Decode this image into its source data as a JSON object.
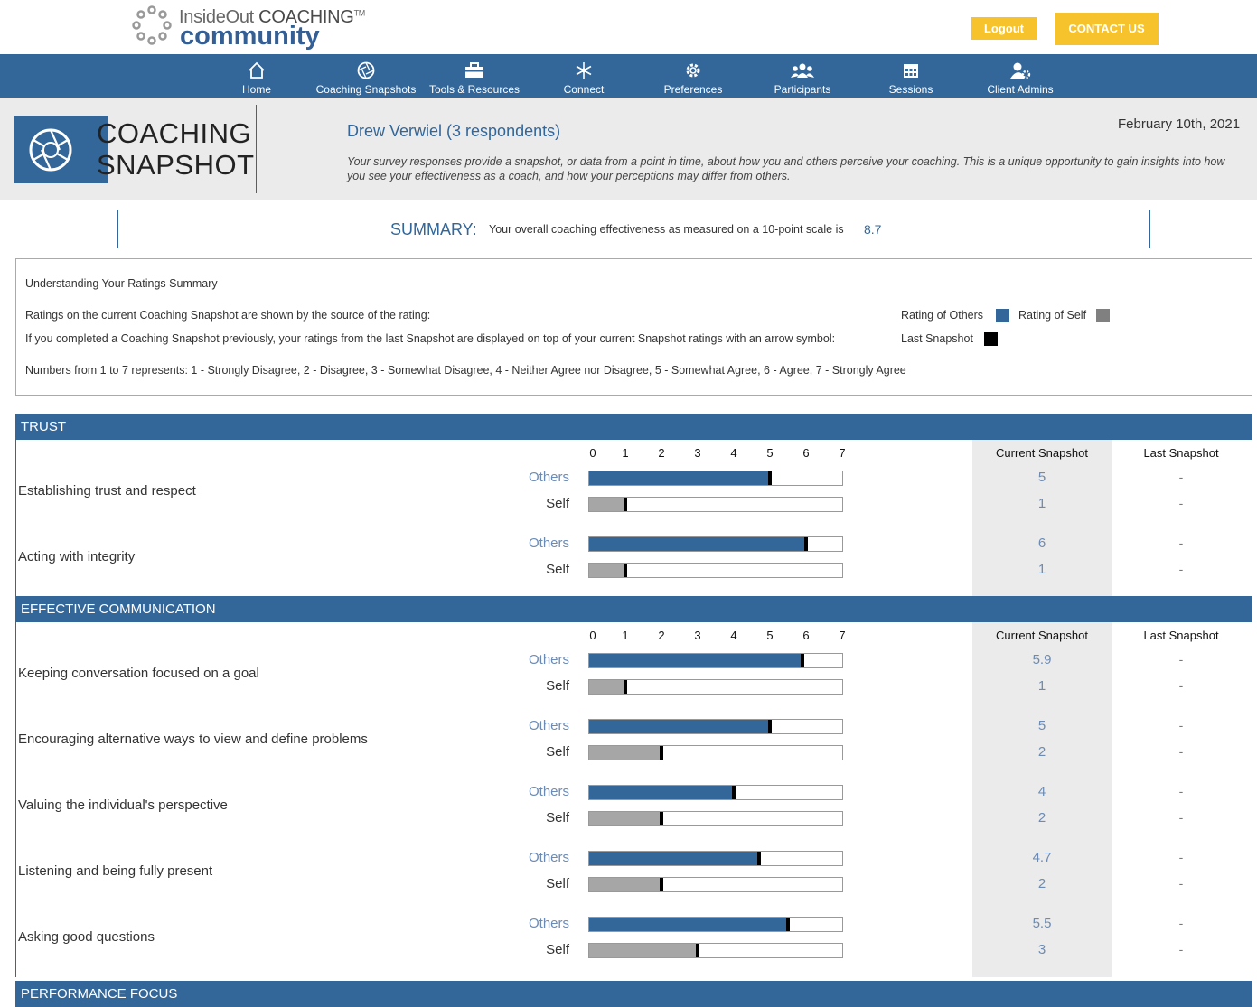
{
  "brand": {
    "line1": "InsideOut",
    "line1_strong": "COACHING",
    "tm": "TM",
    "line2": "community",
    "accent": "#336699",
    "button_color": "#f6c32d"
  },
  "header": {
    "logout": "Logout",
    "contact": "CONTACT US"
  },
  "nav": [
    {
      "label": "Home",
      "icon": "home-icon"
    },
    {
      "label": "Coaching Snapshots",
      "icon": "aperture-icon"
    },
    {
      "label": "Tools & Resources",
      "icon": "toolbox-icon"
    },
    {
      "label": "Connect",
      "icon": "snowflake-icon"
    },
    {
      "label": "Preferences",
      "icon": "gear-icon"
    },
    {
      "label": "Participants",
      "icon": "group-icon"
    },
    {
      "label": "Sessions",
      "icon": "calendar-icon"
    },
    {
      "label": "Client Admins",
      "icon": "user-gear-icon"
    }
  ],
  "hero": {
    "title_line1": "COACHING",
    "title_line2": "SNAPSHOT",
    "name": "Drew Verwiel (3 respondents)",
    "date": "February 10th, 2021",
    "description": "Your survey responses provide a snapshot, or data from a point in time, about how you and others perceive your coaching. This is a unique opportunity to gain insights into how you see your effectiveness as a coach, and how your perceptions may differ from others."
  },
  "summary": {
    "label": "SUMMARY:",
    "text": "Your overall coaching effectiveness as measured on a 10-point scale is",
    "score": "8.7"
  },
  "legend": {
    "title": "Understanding Your Ratings Summary",
    "line1": "Ratings on the current Coaching Snapshot are shown by the source of the rating:",
    "line2": "If you completed a Coaching Snapshot previously, your ratings from the last Snapshot are displayed on top of your current Snapshot ratings with an arrow symbol:",
    "line3": "Numbers from 1 to 7 represents: 1 - Strongly Disagree, 2 - Disagree, 3 - Somewhat Disagree, 4 - Neither Agree nor Disagree, 5 - Somewhat Agree, 6 - Agree, 7 - Strongly Agree",
    "others_label": "Rating of Others",
    "self_label": "Rating of Self",
    "last_label": "Last Snapshot",
    "others_color": "#336699",
    "self_color": "#808080",
    "last_color": "#000000"
  },
  "columns": {
    "current": "Current Snapshot",
    "last": "Last Snapshot"
  },
  "scale_ticks": [
    "0",
    "1",
    "2",
    "3",
    "4",
    "5",
    "6",
    "7"
  ],
  "scale_max": 7,
  "labels": {
    "others": "Others",
    "self": "Self"
  },
  "sections": [
    {
      "title": "TRUST",
      "items": [
        {
          "label": "Establishing trust and respect",
          "others": 5,
          "others_text": "5",
          "self": 1,
          "self_text": "1",
          "last_others": "-",
          "last_self": "-"
        },
        {
          "label": "Acting with integrity",
          "others": 6,
          "others_text": "6",
          "self": 1,
          "self_text": "1",
          "last_others": "-",
          "last_self": "-"
        }
      ]
    },
    {
      "title": "EFFECTIVE COMMUNICATION",
      "items": [
        {
          "label": "Keeping conversation focused on a goal",
          "others": 5.9,
          "others_text": "5.9",
          "self": 1,
          "self_text": "1",
          "last_others": "-",
          "last_self": "-"
        },
        {
          "label": "Encouraging alternative ways to view and define problems",
          "others": 5,
          "others_text": "5",
          "self": 2,
          "self_text": "2",
          "last_others": "-",
          "last_self": "-"
        },
        {
          "label": "Valuing the individual's perspective",
          "others": 4,
          "others_text": "4",
          "self": 2,
          "self_text": "2",
          "last_others": "-",
          "last_self": "-"
        },
        {
          "label": "Listening and being fully present",
          "others": 4.7,
          "others_text": "4.7",
          "self": 2,
          "self_text": "2",
          "last_others": "-",
          "last_self": "-"
        },
        {
          "label": "Asking good questions",
          "others": 5.5,
          "others_text": "5.5",
          "self": 3,
          "self_text": "3",
          "last_others": "-",
          "last_self": "-"
        }
      ]
    },
    {
      "title": "PERFORMANCE FOCUS",
      "items": []
    }
  ]
}
